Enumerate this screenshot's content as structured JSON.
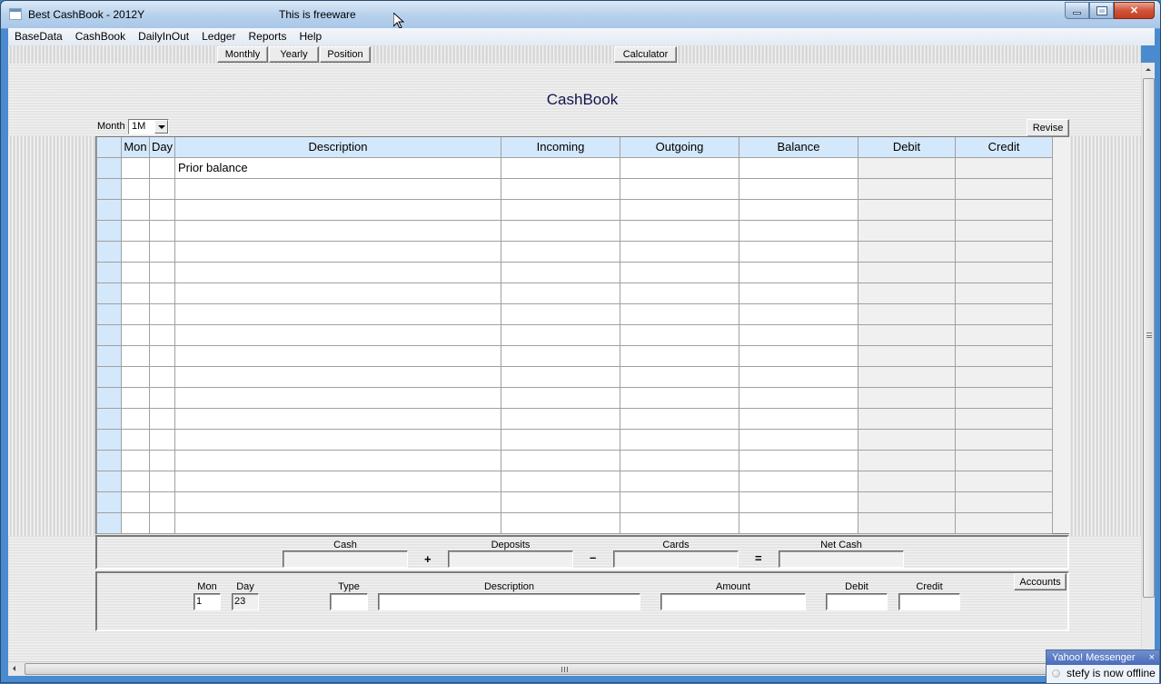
{
  "window": {
    "title": "Best CashBook - 2012Y",
    "subtitle": "This is freeware",
    "controls": {
      "minimize": "minimize",
      "maximize": "maximize",
      "close": "close"
    }
  },
  "menu": {
    "items": [
      "BaseData",
      "CashBook",
      "DailyInOut",
      "Ledger",
      "Reports",
      "Help"
    ]
  },
  "toolbar": {
    "monthly": "Monthly",
    "yearly": "Yearly",
    "position": "Position",
    "calculator": "Calculator"
  },
  "page": {
    "title": "CashBook",
    "month_label": "Month",
    "month_value": "1M",
    "revise": "Revise"
  },
  "grid": {
    "columns": [
      "",
      "Mon",
      "Day",
      "Description",
      "Incoming",
      "Outgoing",
      "Balance",
      "Debit",
      "Credit"
    ],
    "rows": [
      [
        "",
        "",
        "Prior balance",
        "",
        "",
        "",
        "",
        ""
      ],
      [
        "",
        "",
        "",
        "",
        "",
        "",
        "",
        ""
      ],
      [
        "",
        "",
        "",
        "",
        "",
        "",
        "",
        ""
      ],
      [
        "",
        "",
        "",
        "",
        "",
        "",
        "",
        ""
      ],
      [
        "",
        "",
        "",
        "",
        "",
        "",
        "",
        ""
      ],
      [
        "",
        "",
        "",
        "",
        "",
        "",
        "",
        ""
      ],
      [
        "",
        "",
        "",
        "",
        "",
        "",
        "",
        ""
      ],
      [
        "",
        "",
        "",
        "",
        "",
        "",
        "",
        ""
      ],
      [
        "",
        "",
        "",
        "",
        "",
        "",
        "",
        ""
      ],
      [
        "",
        "",
        "",
        "",
        "",
        "",
        "",
        ""
      ],
      [
        "",
        "",
        "",
        "",
        "",
        "",
        "",
        ""
      ],
      [
        "",
        "",
        "",
        "",
        "",
        "",
        "",
        ""
      ],
      [
        "",
        "",
        "",
        "",
        "",
        "",
        "",
        ""
      ],
      [
        "",
        "",
        "",
        "",
        "",
        "",
        "",
        ""
      ],
      [
        "",
        "",
        "",
        "",
        "",
        "",
        "",
        ""
      ],
      [
        "",
        "",
        "",
        "",
        "",
        "",
        "",
        ""
      ],
      [
        "",
        "",
        "",
        "",
        "",
        "",
        "",
        ""
      ],
      [
        "",
        "",
        "",
        "",
        "",
        "",
        "",
        ""
      ]
    ]
  },
  "summary": {
    "cash_label": "Cash",
    "cash_value": "",
    "plus": "+",
    "deposits_label": "Deposits",
    "deposits_value": "",
    "minus": "–",
    "cards_label": "Cards",
    "cards_value": "",
    "equals": "=",
    "net_cash_label": "Net Cash",
    "net_cash_value": ""
  },
  "entry": {
    "mon_label": "Mon",
    "mon_value": "1",
    "day_label": "Day",
    "day_value": "23",
    "type_label": "Type",
    "type_value": "",
    "description_label": "Description",
    "description_value": "",
    "amount_label": "Amount",
    "amount_value": "",
    "debit_label": "Debit",
    "debit_value": "",
    "credit_label": "Credit",
    "credit_value": "",
    "accounts_button": "Accounts"
  },
  "notification": {
    "title": "Yahoo! Messenger",
    "close": "×",
    "message": "stefy is now offline"
  }
}
